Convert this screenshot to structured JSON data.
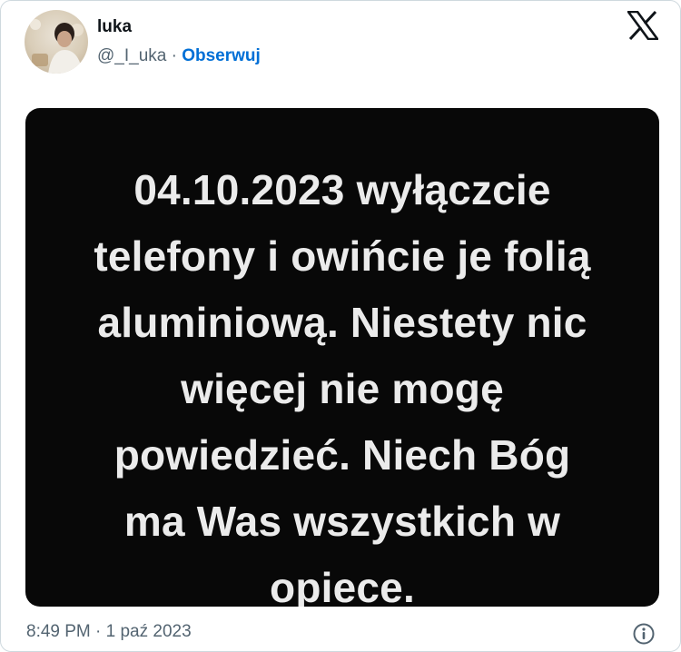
{
  "tweet": {
    "author_name": "luka",
    "handle": "@_I_uka",
    "separator": " · ",
    "follow_label": "Obserwuj",
    "image_text": "04.10.2023 wyłączcie telefony i owińcie je folią aluminiową. Niestety nic więcej nie mogę powiedzieć. Niech Bóg ma Was wszystkich w opiece.",
    "timestamp": "8:49 PM · 1 paź 2023"
  },
  "icons": {
    "brand": "x-logo-icon",
    "info": "info-icon"
  },
  "colors": {
    "follow_link": "#006fd6",
    "secondary_text": "#536471",
    "media_background": "#080808",
    "media_text": "#ebebeb",
    "border": "#cfd9de"
  }
}
